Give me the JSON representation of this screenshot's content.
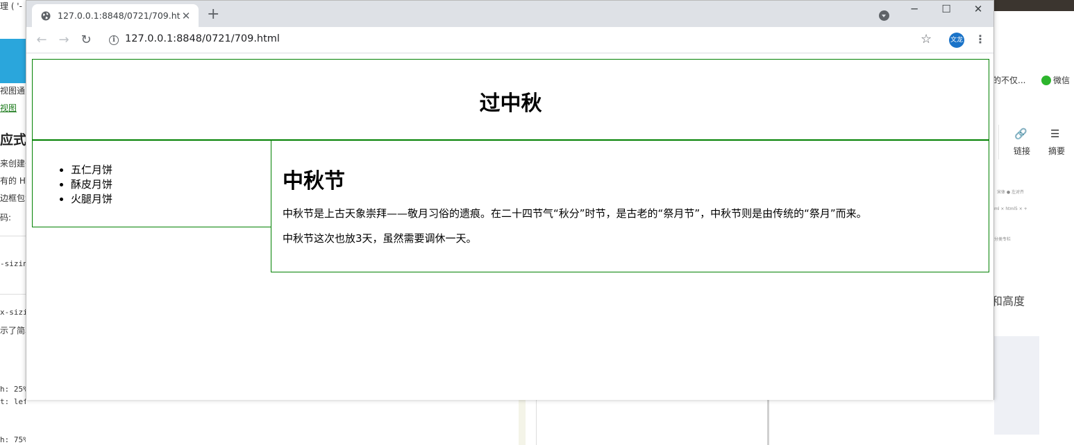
{
  "background": {
    "left": {
      "lines": [
        "理 ( '-",
        "视图通常",
        "视图",
        "应式",
        "来创建一",
        "有的 HT",
        "边框包含",
        "码:",
        "-sizin",
        "x-sizin",
        "示了简单",
        "h: 25%",
        "t: left;",
        "h: 75%;"
      ]
    },
    "right": {
      "lines": [
        "详的不仅...",
        "微信",
        "链接",
        "摘要",
        "和高度"
      ]
    }
  },
  "browser": {
    "tab": {
      "title": "127.0.0.1:8848/0721/709.html",
      "close_glyph": "✕"
    },
    "new_tab_glyph": "+",
    "window_controls": {
      "minimize": "─",
      "maximize": "☐",
      "close": "✕"
    },
    "toolbar": {
      "back_glyph": "←",
      "forward_glyph": "→",
      "reload_glyph": "↻",
      "info_glyph": "i",
      "url": "127.0.0.1:8848/0721/709.html",
      "star_glyph": "☆",
      "avatar_text": "文龙",
      "menu_glyph": "⋮"
    },
    "icons": [
      "globe-icon",
      "plus-icon",
      "chevron-down-icon",
      "info-icon",
      "star-icon"
    ]
  },
  "page": {
    "heading": "过中秋",
    "menu_items": [
      "五仁月饼",
      "酥皮月饼",
      "火腿月饼"
    ],
    "article": {
      "title": "中秋节",
      "paragraphs": [
        "中秋节是上古天象崇拜——敬月习俗的遗痕。在二十四节气“秋分”时节，是古老的“祭月节”，中秋节则是由传统的“祭月”而来。",
        "中秋节这次也放3天，虽然需要调休一天。"
      ]
    }
  },
  "colors": {
    "border_green": "#008000",
    "tabstrip": "#dee1e6",
    "avatar_blue": "#1a73c8"
  }
}
